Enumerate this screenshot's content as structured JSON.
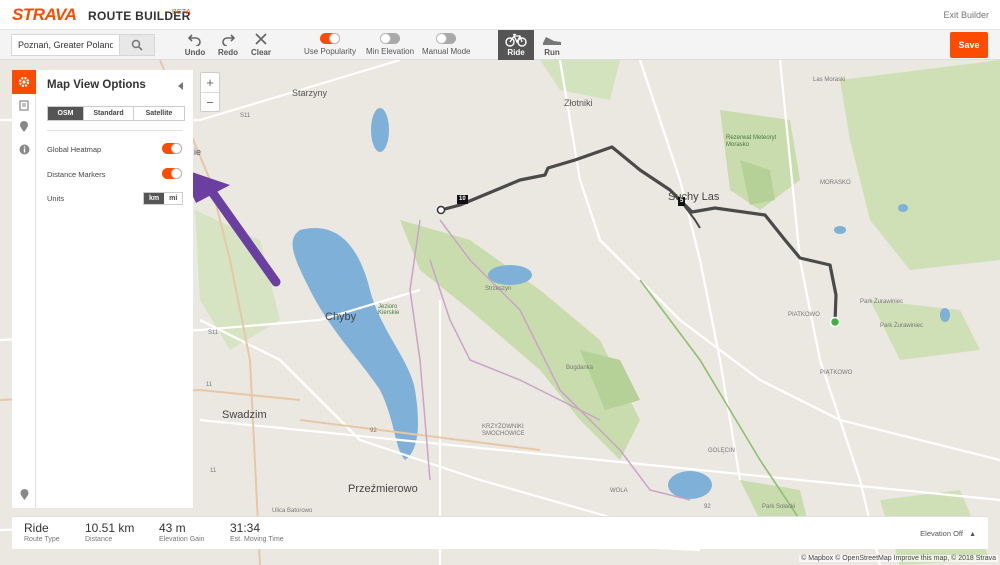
{
  "header": {
    "logo": "STRAVA",
    "product": "ROUTE BUILDER",
    "beta": "BETA",
    "exit": "Exit Builder"
  },
  "toolbar": {
    "search_value": "Poznań, Greater Poland",
    "undo": "Undo",
    "redo": "Redo",
    "clear": "Clear",
    "use_popularity": "Use Popularity",
    "min_elevation": "Min Elevation",
    "manual_mode": "Manual Mode",
    "ride": "Ride",
    "run": "Run",
    "save": "Save"
  },
  "panel": {
    "title": "Map View Options",
    "map_types": [
      "OSM",
      "Standard",
      "Satellite"
    ],
    "global_heatmap": "Global Heatmap",
    "distance_markers": "Distance Markers",
    "units_label": "Units",
    "units_options": [
      "km",
      "mi"
    ]
  },
  "zoom": {
    "in": "+",
    "out": "−"
  },
  "map": {
    "labels": {
      "zlotniki": "Złotniki",
      "starzyny": "Starzyny",
      "suchy_las": "Suchy Las",
      "chyby": "Chyby",
      "swadzim": "Swadzim",
      "przezmierowo": "Przeźmierowo",
      "las_moraski": "Las Moraski",
      "park_zurawiniec": "Park Żurawiniec",
      "park_zurawiniec_2": "Park Żurawiniec",
      "piatkowo": "PIATKOWO",
      "piatkowo_2": "PIĄTKOWO",
      "bogdanka": "Bogdanka",
      "rezerwat": "Rezerwat Meteoryt Morasko",
      "park_solacki": "Park Sołacki",
      "krzyzowniki": "KRZYŻOWNIKI SMOCHOWICE",
      "golecin": "GOLĘCIN",
      "wola": "WOLA",
      "strzeszyn": "Strzeszyn",
      "jezioro": "Jezioro Kierskie",
      "ie": "ie",
      "road_s11": "S11",
      "road_s11b": "S11",
      "road_11": "11",
      "road_11b": "11",
      "road_92": "92",
      "road_92b": "92",
      "ulica_batorowo": "Ulica Batorowo",
      "morasko": "MORASKO"
    },
    "markers": {
      "m10": "10",
      "m5": "5"
    },
    "attribution": "© Mapbox © OpenStreetMap Improve this map, © 2018 Strava"
  },
  "stats": {
    "route_type": {
      "value": "Ride",
      "label": "Route Type"
    },
    "distance": {
      "value": "10.51 km",
      "label": "Distance"
    },
    "elevation": {
      "value": "43 m",
      "label": "Elevation Gain"
    },
    "time": {
      "value": "31:34",
      "label": "Est. Moving Time"
    },
    "elevation_toggle": "Elevation Off"
  },
  "colors": {
    "accent": "#fc4c02",
    "route": "#4a4a4a",
    "water": "#7fb1d8",
    "park": "#c9dcae",
    "arrow": "#6b3fa0"
  }
}
